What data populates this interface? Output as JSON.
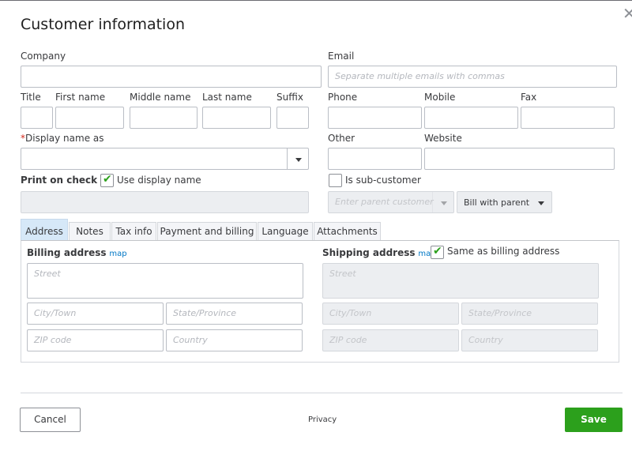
{
  "dialog": {
    "title": "Customer information",
    "close_icon": "close-icon"
  },
  "fields": {
    "company": {
      "label": "Company",
      "value": ""
    },
    "email": {
      "label": "Email",
      "value": "",
      "placeholder": "Separate multiple emails with commas"
    },
    "title": {
      "label": "Title",
      "value": ""
    },
    "first_name": {
      "label": "First name",
      "value": ""
    },
    "middle_name": {
      "label": "Middle name",
      "value": ""
    },
    "last_name": {
      "label": "Last name",
      "value": ""
    },
    "suffix": {
      "label": "Suffix",
      "value": ""
    },
    "phone": {
      "label": "Phone",
      "value": ""
    },
    "mobile": {
      "label": "Mobile",
      "value": ""
    },
    "fax": {
      "label": "Fax",
      "value": ""
    },
    "display_name": {
      "required_mark": "*",
      "label": "Display name as",
      "value": ""
    },
    "other": {
      "label": "Other",
      "value": ""
    },
    "website": {
      "label": "Website",
      "value": ""
    },
    "print_on_check": {
      "label": "Print on check as",
      "checkbox_label": "Use display name",
      "checked": true,
      "value": ""
    },
    "sub_customer": {
      "checkbox_label": "Is sub-customer",
      "checked": false,
      "parent_placeholder": "Enter parent customer",
      "billing_option": "Bill with parent"
    }
  },
  "tabs": [
    {
      "label": "Address",
      "active": true
    },
    {
      "label": "Notes",
      "active": false
    },
    {
      "label": "Tax info",
      "active": false
    },
    {
      "label": "Payment and billing",
      "active": false
    },
    {
      "label": "Language",
      "active": false
    },
    {
      "label": "Attachments",
      "active": false
    }
  ],
  "address": {
    "billing": {
      "title": "Billing address",
      "map_link": "map",
      "street_placeholder": "Street",
      "city_placeholder": "City/Town",
      "state_placeholder": "State/Province",
      "zip_placeholder": "ZIP code",
      "country_placeholder": "Country"
    },
    "shipping": {
      "title": "Shipping address",
      "map_link": "map",
      "same_as_billing_label": "Same as billing address",
      "same_as_billing_checked": true,
      "street_placeholder": "Street",
      "city_placeholder": "City/Town",
      "state_placeholder": "State/Province",
      "zip_placeholder": "ZIP code",
      "country_placeholder": "Country"
    }
  },
  "footer": {
    "cancel_label": "Cancel",
    "privacy_label": "Privacy",
    "save_label": "Save"
  },
  "colors": {
    "accent_green": "#2ca01c",
    "link_blue": "#0077c5",
    "required_red": "#d52b1e",
    "active_tab": "#d6e8f8"
  }
}
